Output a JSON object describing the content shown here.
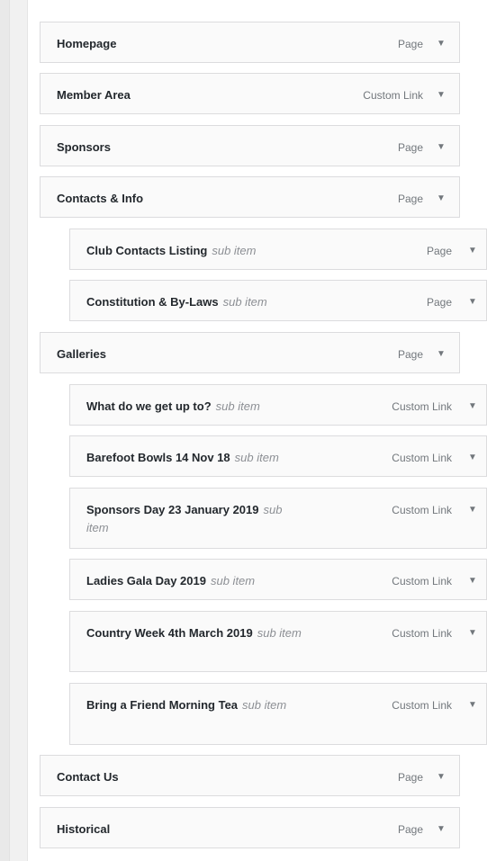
{
  "menu_items": [
    {
      "title": "Homepage",
      "type": "Page",
      "sub": ""
    },
    {
      "title": "Member Area",
      "type": "Custom Link",
      "sub": ""
    },
    {
      "title": "Sponsors",
      "type": "Page",
      "sub": ""
    },
    {
      "title": "Contacts & Info",
      "type": "Page",
      "sub": ""
    },
    {
      "title": "Club Contacts Listing",
      "type": "Page",
      "sub": "sub item"
    },
    {
      "title": "Constitution & By-Laws",
      "type": "Page",
      "sub": "sub item"
    },
    {
      "title": "Galleries",
      "type": "Page",
      "sub": ""
    },
    {
      "title": "What do we get up to?",
      "type": "Custom Link",
      "sub": "sub item"
    },
    {
      "title": "Barefoot Bowls 14 Nov 18",
      "type": "Custom Link",
      "sub": "sub item"
    },
    {
      "title": "Sponsors Day 23 January 2019",
      "type": "Custom Link",
      "sub": "sub item"
    },
    {
      "title": "Ladies Gala Day 2019",
      "type": "Custom Link",
      "sub": "sub item"
    },
    {
      "title": "Country Week 4th March 2019",
      "type": "Custom Link",
      "sub": "sub item"
    },
    {
      "title": "Bring a Friend Morning Tea",
      "type": "Custom Link",
      "sub": "sub item"
    },
    {
      "title": "Contact Us",
      "type": "Page",
      "sub": ""
    },
    {
      "title": "Historical",
      "type": "Page",
      "sub": ""
    }
  ],
  "toggle_icon": "triangle-down-icon"
}
